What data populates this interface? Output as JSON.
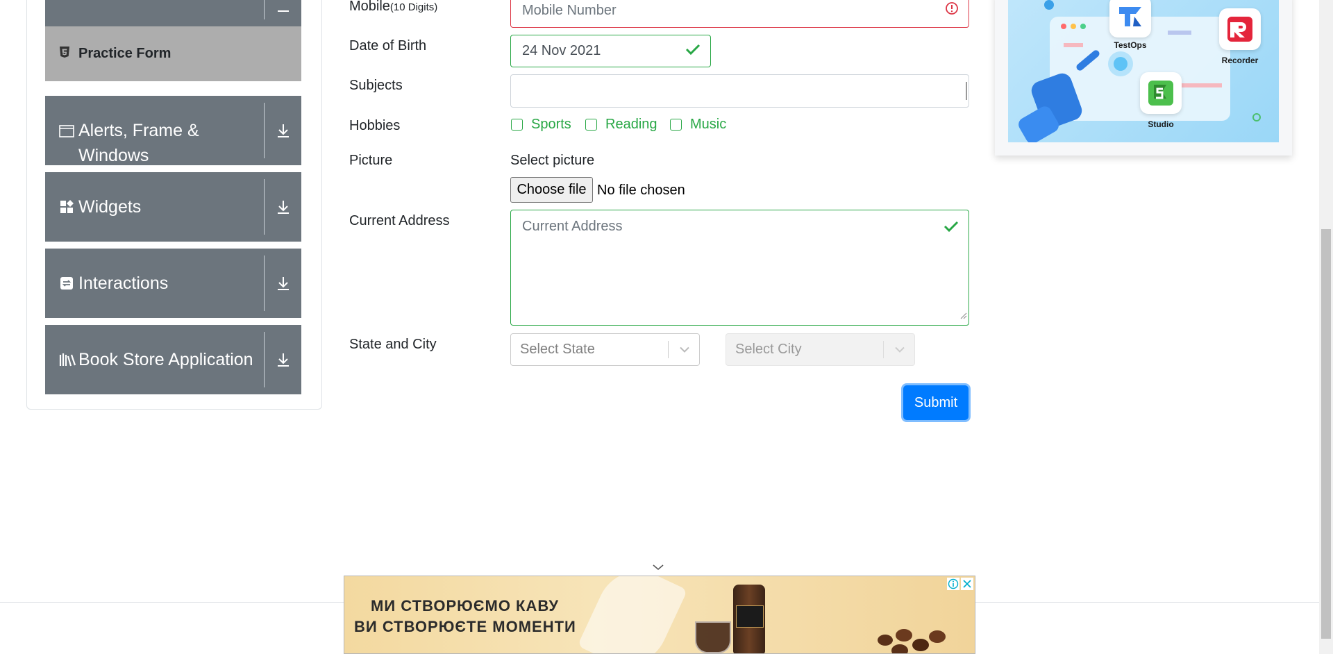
{
  "sidebar": {
    "practice_form_label": "Practice Form",
    "groups": [
      {
        "label_line1": "Alerts, Frame &",
        "label_line2": "Windows",
        "icon": "window-icon"
      },
      {
        "label": "Widgets",
        "icon": "widgets-icon"
      },
      {
        "label": "Interactions",
        "icon": "interactions-icon"
      },
      {
        "label": "Book Store Application",
        "icon": "books-icon"
      }
    ]
  },
  "form": {
    "mobile": {
      "label": "Mobile",
      "label_hint": "(10 Digits)",
      "placeholder": "Mobile Number"
    },
    "dob": {
      "label": "Date of Birth",
      "value": "24 Nov 2021"
    },
    "subjects": {
      "label": "Subjects",
      "value": ""
    },
    "hobbies": {
      "label": "Hobbies",
      "options": [
        "Sports",
        "Reading",
        "Music"
      ]
    },
    "picture": {
      "label": "Picture",
      "select_text": "Select picture",
      "button": "Choose file",
      "status": "No file chosen"
    },
    "address": {
      "label": "Current Address",
      "placeholder": "Current Address"
    },
    "state_city": {
      "label": "State and City",
      "state_placeholder": "Select State",
      "city_placeholder": "Select City"
    },
    "submit": "Submit"
  },
  "promo": {
    "testops": "TestOps",
    "recorder": "Recorder",
    "studio": "Studio"
  },
  "ad": {
    "line1": "МИ СТВОРЮЄМО КАВУ",
    "line2": "ВИ СТВОРЮЄТЕ МОМЕНТИ"
  },
  "colors": {
    "primary": "#007bff",
    "valid": "#28a745",
    "invalid": "#dc3545",
    "sidebar": "#6c757d"
  }
}
